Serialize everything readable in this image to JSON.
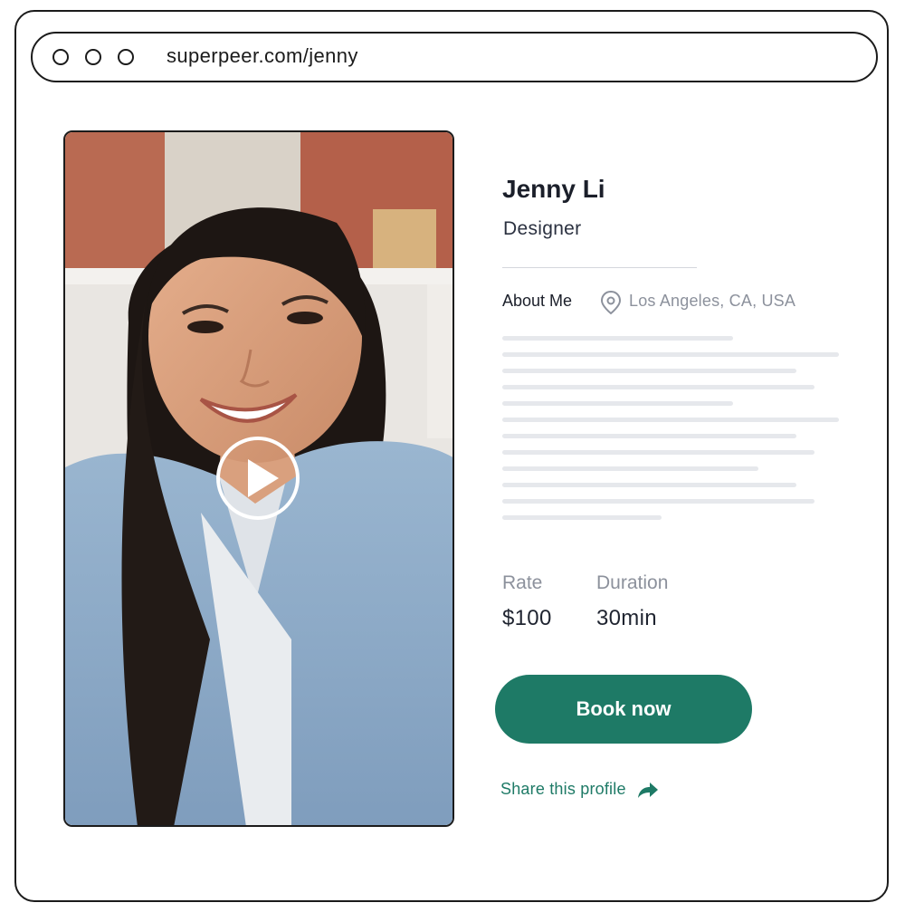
{
  "browser": {
    "url": "superpeer.com/jenny"
  },
  "profile": {
    "name": "Jenny Li",
    "title": "Designer",
    "about_label": "About Me",
    "location": "Los Angeles, CA, USA"
  },
  "pricing": {
    "rate_label": "Rate",
    "rate_value": "$100",
    "duration_label": "Duration",
    "duration_value": "30min"
  },
  "actions": {
    "book_label": "Book now",
    "share_label": "Share this profile"
  },
  "colors": {
    "accent": "#1e7a66",
    "text": "#1f2430",
    "muted": "#8c919c",
    "placeholder_line": "#e6e8ec"
  },
  "icons": [
    "window-dot",
    "play-icon",
    "location-pin-icon",
    "share-arrow-icon"
  ]
}
